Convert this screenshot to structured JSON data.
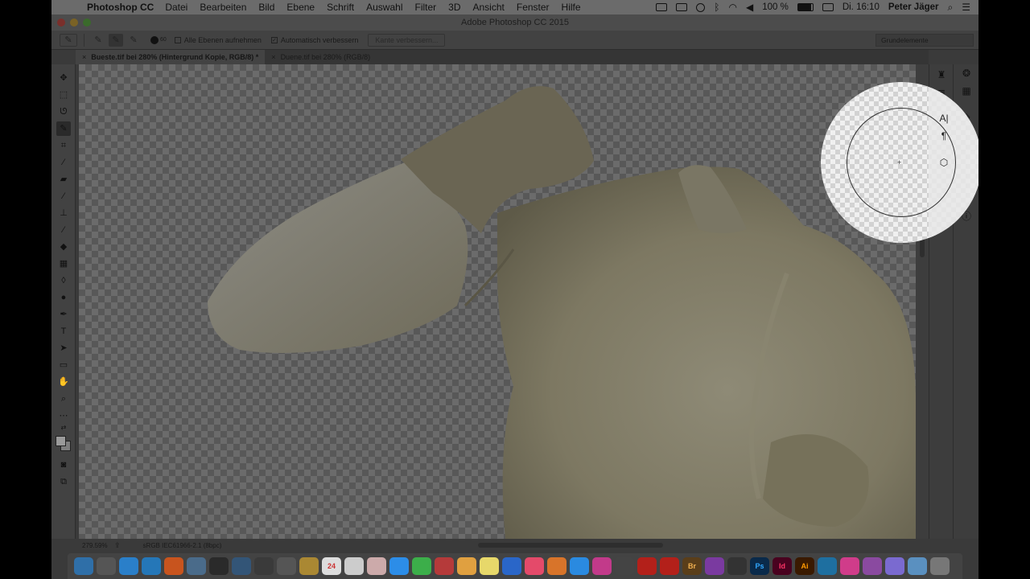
{
  "menubar": {
    "app_name": "Photoshop CC",
    "items": [
      "Datei",
      "Bearbeiten",
      "Bild",
      "Ebene",
      "Schrift",
      "Auswahl",
      "Filter",
      "3D",
      "Ansicht",
      "Fenster",
      "Hilfe"
    ],
    "battery": "100 %",
    "clock": "Di. 16:10",
    "user": "Peter Jäger"
  },
  "window": {
    "title": "Adobe Photoshop CC 2015"
  },
  "options": {
    "brush_size": "60",
    "sample_all_layers": "Alle Ebenen aufnehmen",
    "auto_enhance": "Automatisch verbessern",
    "refine_edge": "Kante verbessern...",
    "workspace": "Grundelemente"
  },
  "tabs": [
    {
      "label": "Bueste.tif bei 280% (Hintergrund Kopie, RGB/8) *"
    },
    {
      "label": "Duene.tif bei 280% (RGB/8)"
    }
  ],
  "status": {
    "zoom": "279.59%",
    "profile": "sRGB IEC61966-2.1 (8bpc)"
  },
  "colors": {
    "accent_photoshop": "#31a8ff",
    "accent_illustrator": "#ff9a00",
    "accent_indesign": "#ff3366"
  }
}
